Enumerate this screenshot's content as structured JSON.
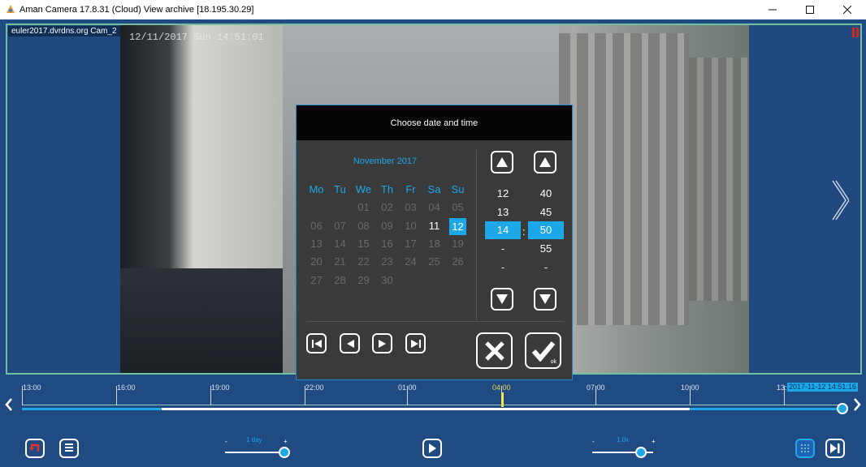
{
  "window": {
    "title": "Aman Camera 17.8.31 (Cloud) View archive [18.195.30.29]",
    "minimize": "–",
    "maximize": "☐",
    "close": "✕"
  },
  "video": {
    "camera_label": "euler2017.dvrdns.org Cam_2",
    "osd_timestamp": "12/11/2017 Sun 14:51:01"
  },
  "date_dialog": {
    "title": "Choose date and time",
    "month": "November 2017",
    "weekdays": [
      "Mo",
      "Tu",
      "We",
      "Th",
      "Fr",
      "Sa",
      "Su"
    ],
    "weeks": [
      [
        "",
        "",
        "01",
        "02",
        "03",
        "04",
        "05"
      ],
      [
        "06",
        "07",
        "08",
        "09",
        "10",
        "11",
        "12"
      ],
      [
        "13",
        "14",
        "15",
        "16",
        "17",
        "18",
        "19"
      ],
      [
        "20",
        "21",
        "22",
        "23",
        "24",
        "25",
        "26"
      ],
      [
        "27",
        "28",
        "29",
        "30",
        "",
        "",
        ""
      ]
    ],
    "selected_day": "12",
    "highlight_day": "11",
    "hours": [
      "12",
      "13",
      "14",
      "-",
      "-"
    ],
    "minutes": [
      "40",
      "45",
      "50",
      "55",
      "-"
    ],
    "selected_hour": "14",
    "selected_minute": "50",
    "separator": ":",
    "ok_label": "ok"
  },
  "timeline": {
    "ticks": [
      "13:00",
      "16:00",
      "19:00",
      "22:00",
      "01:00",
      "04:00",
      "07:00",
      "10:00",
      "13:00"
    ],
    "current_tick": "04:00",
    "current_position_badge": "2017-11-12 14:51:16"
  },
  "bottom": {
    "range_minus": "-",
    "range_plus": "+",
    "range_value": "1 day",
    "speed_minus": "-",
    "speed_plus": "+",
    "speed_value": "1.0x"
  },
  "colors": {
    "background": "#1f4a82",
    "accent": "#1ca7e8",
    "frame_border": "#6fbfa0",
    "dialog_bg": "#3a3a3a"
  }
}
